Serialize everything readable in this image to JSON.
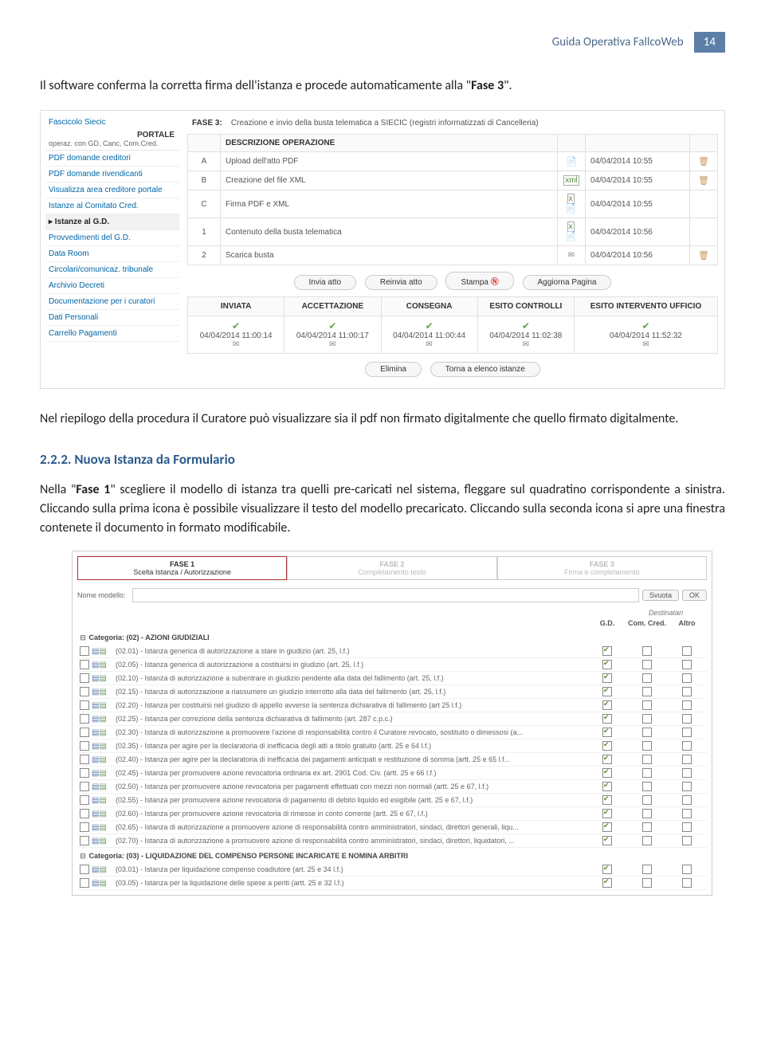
{
  "header": {
    "guide": "Guida Operativa FallcoWeb",
    "page": "14"
  },
  "para1_a": "Il software conferma la corretta firma dell'istanza e procede automaticamente alla \"",
  "para1_b": "Fase 3",
  "para1_c": "\".",
  "shot1": {
    "sidebar": {
      "top": "Fascicolo Siecic",
      "portale": "PORTALE",
      "portale_sub": "operaz. con GD, Canc, Com.Cred.",
      "items": [
        "PDF domande creditori",
        "PDF domande rivendicanti",
        "Visualizza area creditore portale",
        "Istanze al Comitato Cred.",
        "Istanze al G.D.",
        "Provvedimenti del G.D.",
        "Data Room",
        "Circolari/comunicaz. tribunale",
        "Archivio Decreti",
        "Documentazione per i curatori",
        "Dati Personali",
        "Carrello Pagamenti"
      ],
      "active_index": 4
    },
    "fase_label": "FASE 3:",
    "fase_desc": "Creazione e invio della busta telematica a SIECIC (registri informatizzati di Cancelleria)",
    "op_header": "DESCRIZIONE OPERAZIONE",
    "rows": [
      {
        "code": "A",
        "desc": "Upload dell'atto PDF",
        "icon": "pdf",
        "date": "04/04/2014 10:55",
        "del": true
      },
      {
        "code": "B",
        "desc": "Creazione del file XML",
        "icon": "xml",
        "date": "04/04/2014 10:55",
        "del": true
      },
      {
        "code": "C",
        "desc": "Firma PDF e XML",
        "icon": "sig",
        "date": "04/04/2014 10:55",
        "del": false
      },
      {
        "code": "1",
        "desc": "Contenuto della busta telematica",
        "icon": "pair",
        "date": "04/04/2014 10:56",
        "del": false
      },
      {
        "code": "2",
        "desc": "Scarica busta",
        "icon": "env",
        "date": "04/04/2014 10:56",
        "del": true
      }
    ],
    "buttons": {
      "invia": "Invia atto",
      "reinvia": "Reinvia atto",
      "stampa": "Stampa",
      "aggiorna": "Aggiorna Pagina"
    },
    "status_headers": [
      "INVIATA",
      "ACCETTAZIONE",
      "CONSEGNA",
      "ESITO CONTROLLI",
      "ESITO INTERVENTO UFFICIO"
    ],
    "status_values": [
      "04/04/2014 11:00:14",
      "04/04/2014 11:00:17",
      "04/04/2014 11:00:44",
      "04/04/2014 11:02:38",
      "04/04/2014 11:52:32"
    ],
    "bottom_buttons": {
      "elimina": "Elimina",
      "torna": "Torna a elenco istanze"
    }
  },
  "para2": "Nel riepilogo della procedura il Curatore può visualizzare sia il pdf non firmato digitalmente che quello firmato digitalmente.",
  "heading": "2.2.2.  Nuova Istanza da Formulario",
  "para3_a": "Nella \"",
  "para3_b": "Fase 1",
  "para3_c": "\" scegliere il modello di istanza tra quelli pre-caricati nel sistema, fleggare sul quadratino corrispondente a sinistra. Cliccando sulla prima icona è possibile visualizzare il testo del modello precaricato. Cliccando sulla seconda icona si apre una finestra contenete il documento in formato modificabile.",
  "shot2": {
    "phases": [
      {
        "t": "FASE 1",
        "s": "Scelta Istanza / Autorizzazione"
      },
      {
        "t": "FASE 2",
        "s": "Completamento testo"
      },
      {
        "t": "FASE 3",
        "s": "Firma e completamento"
      }
    ],
    "search_label": "Nome modello:",
    "btn_svuota": "Svuota",
    "btn_ok": "OK",
    "dest_label": "Destinatari",
    "col_gd": "G.D.",
    "col_cc": "Com. Cred.",
    "col_altro": "Altro",
    "cat1": "Categoria: (02) - AZIONI GIUDIZIALI",
    "cat2": "Categoria: (03) - LIQUIDAZIONE DEL COMPENSO PERSONE INCARICATE E NOMINA ARBITRI",
    "rows1": [
      {
        "d": "(02.01) - Istanza generica di autorizzazione a stare in giudizio (art. 25, l.f.)",
        "gd": true
      },
      {
        "d": "(02.05) - Istanza generica di autorizzazione a costituirsi in giudizio (art. 25, l.f.)",
        "gd": true
      },
      {
        "d": "(02.10) - Istanza di autorizzazione a subentrare in giudizio pendente alla data del fallimento (art. 25, l.f.)",
        "gd": true
      },
      {
        "d": "(02.15) - Istanza di autorizzazione a riassumere un giudizio interrotto alla data del fallimento (art. 25, l.f.)",
        "gd": true
      },
      {
        "d": "(02.20) - Istanza per costituirsi nel giudizio di appello avverso la sentenza dichiarativa di fallimento (art 25 l.f.)",
        "gd": true
      },
      {
        "d": "(02.25) - Istanza per correzione della sentenza dichiarativa di fallimento (art. 287 c.p.c.)",
        "gd": true
      },
      {
        "d": "(02.30) - Istanza di autorizzazione a promuovere l'azione di responsabilità contro il Curatore revocato, sostituito o dimessosi (a...",
        "gd": true
      },
      {
        "d": "(02.35) - Istanza per agire per la declaratoria di inefficacia degli atti a titolo gratuito (artt. 25 e 64 l.f.)",
        "gd": true
      },
      {
        "d": "(02.40) - Istanza per agire per la declaratoria di inefficacia dei pagamenti anticipati e restituzione di somma (artt. 25 e 65 l.f...",
        "gd": true
      },
      {
        "d": "(02.45) - Istanza per promuovere azione revocatoria ordinaria ex art. 2901 Cod. Civ. (artt. 25 e 66 l.f.)",
        "gd": true
      },
      {
        "d": "(02.50) - Istanza per promuovere azione revocatoria per pagamenti effettuati con mezzi non normali (artt. 25 e 67, l.f.)",
        "gd": true
      },
      {
        "d": "(02.55) - Istanza per promuovere azione revocatoria di pagamento di debito liquido ed esigibile (artt. 25 e 67, l.f.)",
        "gd": true
      },
      {
        "d": "(02.60) - Istanza per promuovere azione revocatoria di rimesse in conto corrente (artt. 25 e 67, l.f.)",
        "gd": true
      },
      {
        "d": "(02.65) - Istanza di autorizzazione a promuovere azione di responsabilità contro amministratori, sindaci, direttori generali, liqu...",
        "gd": true
      },
      {
        "d": "(02.70) - Istanza di autorizzazione a promuovere azione di responsabilità contro amministratori, sindaci, direttori, liquidatori, ...",
        "gd": true
      }
    ],
    "rows2": [
      {
        "d": "(03.01) - Istanza per liquidazione compenso coadiutore (art. 25 e 34 l.f.)",
        "gd": true
      },
      {
        "d": "(03.05) - Istanza per la liquidazione delle spese a periti (artt. 25 e 32 l.f.)",
        "gd": true
      }
    ]
  }
}
